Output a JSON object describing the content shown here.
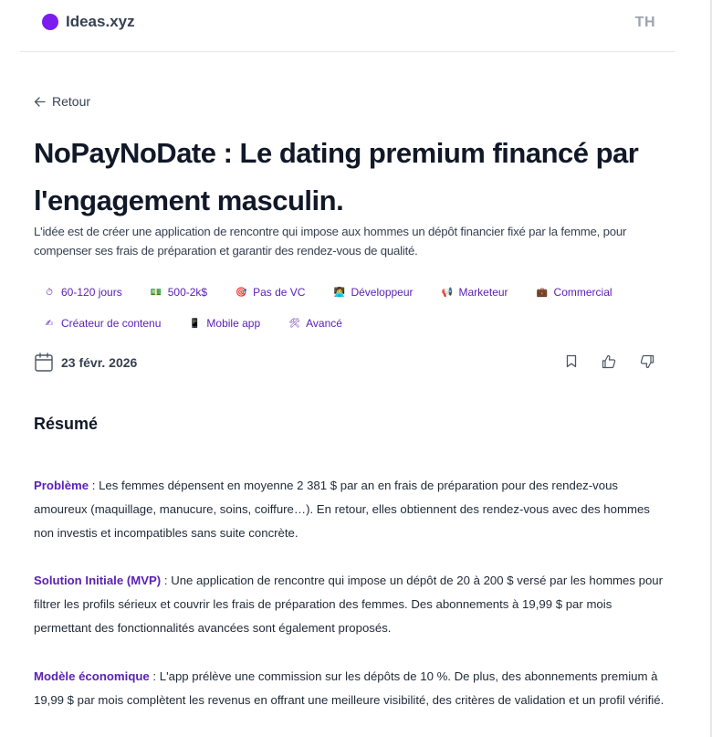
{
  "header": {
    "logo_text": "Ideas.xyz",
    "avatar_initials": "TH",
    "accent": "#7c1df0"
  },
  "nav": {
    "back_label": "Retour"
  },
  "idea": {
    "title": "NoPayNoDate : Le dating premium financé par l'engagement masculin.",
    "lede": "L'idée est de créer une application de rencontre qui impose aux hommes un dépôt financier fixé par la femme, pour compenser ses frais de préparation et garantir des rendez-vous de qualité."
  },
  "tags": [
    {
      "emoji": "⏱",
      "label": "60-120 jours"
    },
    {
      "emoji": "💵",
      "label": "500-2k$"
    },
    {
      "emoji": "🎯",
      "label": "Pas de VC"
    },
    {
      "emoji": "👩‍💻",
      "label": "Développeur"
    },
    {
      "emoji": "📢",
      "label": "Marketeur"
    },
    {
      "emoji": "💼",
      "label": "Commercial"
    },
    {
      "emoji": "✍",
      "label": "Créateur de contenu"
    },
    {
      "emoji": "📱",
      "label": "Mobile app"
    },
    {
      "emoji": "🛠",
      "label": "Avancé"
    }
  ],
  "meta": {
    "date": "23 févr. 2026"
  },
  "summary": {
    "heading": "Résumé",
    "sections": [
      {
        "label": "Problème",
        "text": " : Les femmes dépensent en moyenne 2 381 $ par an en frais de préparation pour des rendez-vous amoureux (maquillage, manucure, soins, coiffure…). En retour, elles obtiennent des rendez-vous avec des hommes non investis et incompatibles sans suite concrète."
      },
      {
        "label": "Solution Initiale (MVP)",
        "text": " : Une application de rencontre qui impose un dépôt de 20 à 200 $ versé par les hommes pour filtrer les profils sérieux et couvrir les frais de préparation des femmes. Des abonnements à 19,99 $ par mois permettant des fonctionnalités avancées sont également proposés."
      },
      {
        "label": "Modèle économique",
        "text": " : L'app prélève une commission sur les dépôts de 10 %. De plus, des abonnements premium à 19,99 $ par mois complètent les revenus en offrant une meilleure visibilité, des critères de validation et un profil vérifié."
      }
    ]
  }
}
